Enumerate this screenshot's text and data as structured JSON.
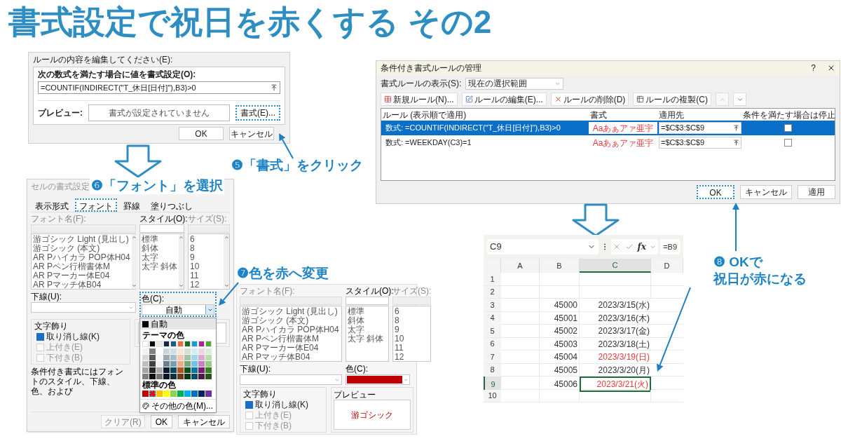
{
  "title": "書式設定で祝日を赤くする その2",
  "rule_dialog": {
    "heading": "ルールの内容を編集してください(E):",
    "formula_label": "次の数式を満たす場合に値を書式設定(O):",
    "formula": "=COUNTIF(INDIRECT(\"T_休日[日付]\"),B3)>0",
    "preview_label": "プレビュー:",
    "preview_text": "書式が設定されていません",
    "format_button": {
      "label": "書式(E)...",
      "highlighted": true
    },
    "buttons": [
      "OK",
      "キャンセル"
    ]
  },
  "step5": "❺「書式」をクリック",
  "step6": "❻「フォント」を選択",
  "format_dialog": {
    "title": "セルの書式設定",
    "tabs": [
      {
        "label": "表示形式",
        "selected": false
      },
      {
        "label": "フォント",
        "selected": true
      },
      {
        "label": "罫線",
        "selected": false
      },
      {
        "label": "塗りつぶし",
        "selected": false
      }
    ],
    "font_label": "フォント名(F):",
    "fonts": [
      "游ゴシック Light (見出し)",
      "游ゴシック (本文)",
      "AR Pハイカラ POP体H04",
      "AR Pペン行楷書体M",
      "AR Pマーカー体E04",
      "AR Pマッチ体B04"
    ],
    "style_label": "スタイル(O):",
    "styles": [
      "標準",
      "斜体",
      "太字",
      "太字 斜体"
    ],
    "size_label": "サイズ(S):",
    "sizes": [
      "6",
      "8",
      "9",
      "10",
      "11",
      "12"
    ],
    "underline_label": "下線(U):",
    "color_label": "色(C):",
    "color_value": "自動",
    "color_highlighted": true,
    "effects_label": "文字飾り",
    "effects": [
      {
        "label": "取り消し線(K)",
        "checked": true,
        "disabled": false
      },
      {
        "label": "上付き(E)",
        "checked": false,
        "disabled": true
      },
      {
        "label": "下付き(B)",
        "checked": false,
        "disabled": true
      }
    ],
    "note": "条件付き書式にはフォントのスタイル、下線、色、および",
    "clear_button": "クリア(R)",
    "buttons": [
      "OK",
      "キャンセル"
    ],
    "color_menu": {
      "auto": "自動",
      "theme_label": "テーマの色",
      "theme_colors": [
        {
          "color": "#ffffff"
        },
        {
          "color": "#000000"
        },
        {
          "color": "#e8e8e8"
        },
        {
          "color": "#0e2841"
        },
        {
          "color": "#156082"
        },
        {
          "color": "#e97132"
        },
        {
          "color": "#196b24"
        },
        {
          "color": "#0f9ed5"
        },
        {
          "color": "#a02b93"
        },
        {
          "color": "#4ea72e"
        }
      ],
      "standard_label": "標準の色",
      "standard_colors": [
        {
          "color": "#c00000",
          "selected": false
        },
        {
          "color": "#ff0000",
          "selected": true
        },
        {
          "color": "#ffc000",
          "selected": false
        },
        {
          "color": "#ffff00",
          "selected": false
        },
        {
          "color": "#92d050",
          "selected": false
        },
        {
          "color": "#00b050",
          "selected": false
        },
        {
          "color": "#00b0f0",
          "selected": false
        },
        {
          "color": "#0070c0",
          "selected": false
        },
        {
          "color": "#002060",
          "selected": false
        },
        {
          "color": "#7030a0",
          "selected": false
        }
      ],
      "more": "その他の色(M)..."
    }
  },
  "step7": "❼色を赤へ変更",
  "result_dialog": {
    "font_label": "フォント名(F):",
    "fonts": [
      "游ゴシック Light (見出し)",
      "游ゴシック (本文)",
      "AR Pハイカラ POP体H04",
      "AR Pペン行楷書体M",
      "AR Pマーカー体E04",
      "AR Pマッチ体B04"
    ],
    "style_label": "スタイル(O):",
    "styles": [
      "標準",
      "斜体",
      "太字",
      "太字 斜体"
    ],
    "size_label": "サイズ(S):",
    "sizes": [
      "6",
      "8",
      "9",
      "10",
      "11",
      "12"
    ],
    "underline_label": "下線(U):",
    "color_label": "色(C):",
    "color": "#c00000",
    "effects_label": "文字飾り",
    "effects": [
      {
        "label": "取り消し線(K)",
        "checked": true,
        "disabled": false
      },
      {
        "label": "上付き(E)",
        "checked": false,
        "disabled": true
      },
      {
        "label": "下付き(B)",
        "checked": false,
        "disabled": true
      }
    ],
    "preview_label": "プレビュー",
    "preview_text": "游ゴシック"
  },
  "manager_dialog": {
    "title": "条件付き書式ルールの管理",
    "help": "?",
    "show_label": "書式ルールの表示(S):",
    "show_value": "現在の選択範囲",
    "toolbar": [
      {
        "kind": "new",
        "label": "新規ルール(N)..."
      },
      {
        "kind": "edit",
        "label": "ルールの編集(E)..."
      },
      {
        "kind": "delete",
        "label": "ルールの削除(D)"
      },
      {
        "kind": "copy",
        "label": "ルールの複製(C)"
      }
    ],
    "columns": [
      "ルール (表示順で適用)",
      "書式",
      "適用先",
      "条件を満たす場合は停止"
    ],
    "rules": [
      {
        "rule": "数式: =COUNTIF(INDIRECT(\"T_休日[日付]\"),B3)>0",
        "sample": "Aaあぁアァ亜宇",
        "applies_to": "=$C$3:$C$9",
        "stop": false,
        "selected": true
      },
      {
        "rule": "数式: =WEEKDAY(C3)=1",
        "sample": "Aaあぁアァ亜宇",
        "applies_to": "=$C$3:$C$9",
        "stop": false,
        "selected": false
      }
    ],
    "buttons": [
      {
        "label": "OK",
        "highlighted": true
      },
      {
        "label": "キャンセル",
        "highlighted": false
      },
      {
        "label": "適用",
        "highlighted": false
      }
    ]
  },
  "sheet": {
    "name_box": "C9",
    "fx": "fx",
    "formula": "=B9",
    "columns": [
      {
        "label": "A",
        "selected": false
      },
      {
        "label": "B",
        "selected": false
      },
      {
        "label": "C",
        "selected": true
      },
      {
        "label": "D",
        "selected": false
      }
    ],
    "rows": [
      {
        "number": "1",
        "selected": false
      },
      {
        "number": "2",
        "selected": false
      },
      {
        "number": "3",
        "id": "45000",
        "date": "2023/3/15(水)",
        "holiday": false,
        "selected": false
      },
      {
        "number": "4",
        "id": "45001",
        "date": "2023/3/16(木)",
        "holiday": false,
        "selected": false
      },
      {
        "number": "5",
        "id": "45002",
        "date": "2023/3/17(金)",
        "holiday": false,
        "selected": false
      },
      {
        "number": "6",
        "id": "45003",
        "date": "2023/3/18(土)",
        "holiday": false,
        "selected": false
      },
      {
        "number": "7",
        "id": "45004",
        "date": "2023/3/19(日)",
        "holiday": true,
        "selected": false
      },
      {
        "number": "8",
        "id": "45005",
        "date": "2023/3/20(月)",
        "holiday": false,
        "selected": false
      },
      {
        "number": "9",
        "id": "45006",
        "date": "2023/3/21(火)",
        "holiday": true,
        "selected": true
      },
      {
        "number": "10",
        "selected": false
      }
    ]
  },
  "step8": [
    "❽ OKで",
    "祝日が赤になる"
  ]
}
